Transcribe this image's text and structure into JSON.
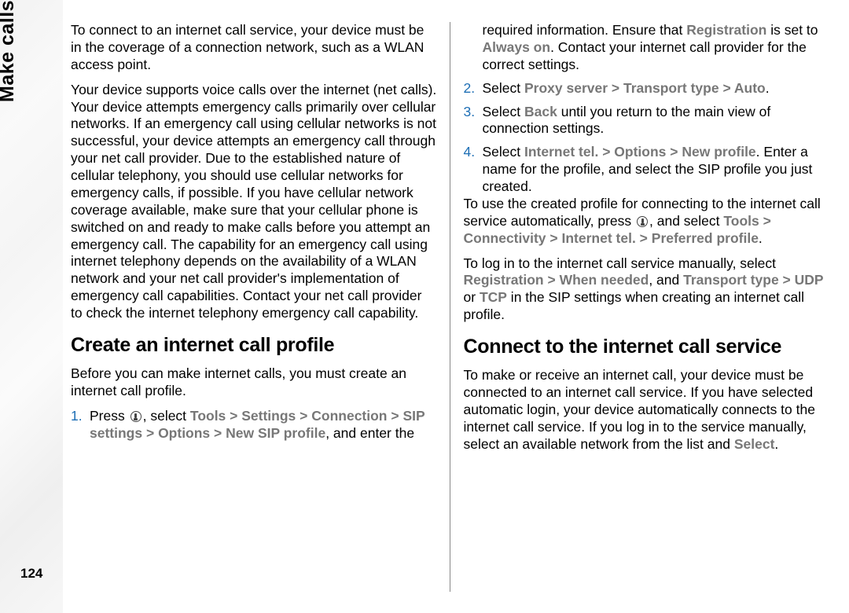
{
  "side": {
    "chapter": "Make calls",
    "page_number": "124"
  },
  "col": {
    "p1": "To connect to an internet call service, your device must be in the coverage of a connection network, such as a WLAN access point.",
    "p2": "Your device supports voice calls over the internet (net calls). Your device attempts emergency calls primarily over cellular networks. If an emergency call using cellular networks is not successful, your device attempts an emergency call through your net call provider. Due to the established nature of cellular telephony, you should use cellular networks for emergency calls, if possible. If you have cellular network coverage available, make sure that your cellular phone is switched on and ready to make calls before you attempt an emergency call. The capability for an emergency call using internet telephony depends on the availability of a WLAN network and your net call provider's implementation of emergency call capabilities. Contact your net call provider to check the internet telephony emergency call capability.",
    "h_create": "Create an internet call profile",
    "p3": "Before you can make internet calls, you must create an internet call profile.",
    "step1": {
      "num": "1.",
      "a": "Press ",
      "b": ", select ",
      "tools": "Tools",
      "gt1": " > ",
      "settings": "Settings",
      "gt2": " > ",
      "connection": "Connection",
      "gt3": " > ",
      "sipsettings": "SIP settings",
      "gt4": " > ",
      "options": "Options",
      "gt5": " > ",
      "newsip": "New SIP profile",
      "c": ", and enter the required information. Ensure that ",
      "registration": "Registration",
      "d": " is set to ",
      "alwayson": "Always on",
      "e": ". Contact your internet call provider for the correct settings."
    },
    "step2": {
      "num": "2.",
      "a": "Select ",
      "proxy": "Proxy server",
      "gt1": " > ",
      "transport": "Transport type",
      "gt2": " > ",
      "auto": "Auto",
      "b": "."
    },
    "step3": {
      "num": "3.",
      "a": "Select ",
      "back": "Back",
      "b": " until you return to the main view of connection settings."
    },
    "step4": {
      "num": "4.",
      "a": "Select ",
      "inettel": "Internet tel.",
      "gt1": " > ",
      "options": "Options",
      "gt2": " > ",
      "newprofile": "New profile",
      "b": ". Enter a name for the profile, and select the SIP profile you just created."
    },
    "p5": {
      "a": "To use the created profile for connecting to the internet call service automatically, press ",
      "b": ", and select ",
      "tools": "Tools",
      "gt1": " > ",
      "connectivity": "Connectivity",
      "gt2": " > ",
      "inettel": "Internet tel.",
      "gt3": " > ",
      "preferred": "Preferred profile",
      "c": "."
    },
    "p6": {
      "a": "To log in to the internet call service manually, select ",
      "registration": "Registration",
      "gt1": " > ",
      "whenneeded": "When needed",
      "b": ", and ",
      "transport": "Transport type",
      "gt2": " > ",
      "udp": "UDP",
      "c": " or ",
      "tcp": "TCP",
      "d": " in the SIP settings when creating an internet call profile."
    },
    "h_connect": "Connect to the internet call service",
    "p7": {
      "a": "To make or receive an internet call, your device must be connected to an internet call service. If you have selected automatic login, your device automatically connects to the internet call service. If you log in to the service manually, select an available network from the list and ",
      "select": "Select",
      "b": "."
    }
  }
}
